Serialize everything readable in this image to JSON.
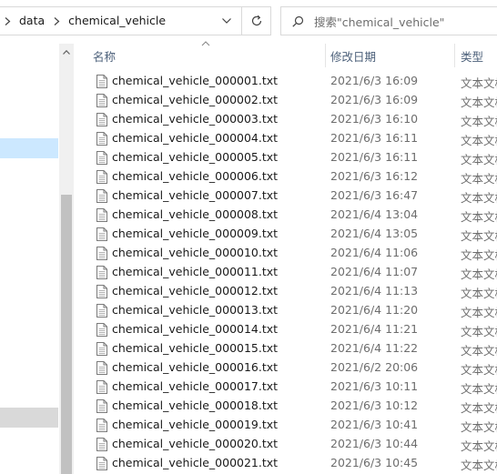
{
  "breadcrumb": {
    "items": [
      "data",
      "chemical_vehicle"
    ]
  },
  "search": {
    "placeholder": "搜索\"chemical_vehicle\""
  },
  "columns": {
    "name": "名称",
    "date": "修改日期",
    "type": "类型"
  },
  "files": [
    {
      "name": "chemical_vehicle_000001.txt",
      "date": "2021/6/3 16:09",
      "type": "文本文档"
    },
    {
      "name": "chemical_vehicle_000002.txt",
      "date": "2021/6/3 16:09",
      "type": "文本文档"
    },
    {
      "name": "chemical_vehicle_000003.txt",
      "date": "2021/6/3 16:10",
      "type": "文本文档"
    },
    {
      "name": "chemical_vehicle_000004.txt",
      "date": "2021/6/3 16:11",
      "type": "文本文档"
    },
    {
      "name": "chemical_vehicle_000005.txt",
      "date": "2021/6/3 16:11",
      "type": "文本文档"
    },
    {
      "name": "chemical_vehicle_000006.txt",
      "date": "2021/6/3 16:12",
      "type": "文本文档"
    },
    {
      "name": "chemical_vehicle_000007.txt",
      "date": "2021/6/3 16:47",
      "type": "文本文档"
    },
    {
      "name": "chemical_vehicle_000008.txt",
      "date": "2021/6/4 13:04",
      "type": "文本文档"
    },
    {
      "name": "chemical_vehicle_000009.txt",
      "date": "2021/6/4 13:05",
      "type": "文本文档"
    },
    {
      "name": "chemical_vehicle_000010.txt",
      "date": "2021/6/4 11:06",
      "type": "文本文档"
    },
    {
      "name": "chemical_vehicle_000011.txt",
      "date": "2021/6/4 11:07",
      "type": "文本文档"
    },
    {
      "name": "chemical_vehicle_000012.txt",
      "date": "2021/6/4 11:13",
      "type": "文本文档"
    },
    {
      "name": "chemical_vehicle_000013.txt",
      "date": "2021/6/4 11:20",
      "type": "文本文档"
    },
    {
      "name": "chemical_vehicle_000014.txt",
      "date": "2021/6/4 11:21",
      "type": "文本文档"
    },
    {
      "name": "chemical_vehicle_000015.txt",
      "date": "2021/6/4 11:22",
      "type": "文本文档"
    },
    {
      "name": "chemical_vehicle_000016.txt",
      "date": "2021/6/2 20:06",
      "type": "文本文档"
    },
    {
      "name": "chemical_vehicle_000017.txt",
      "date": "2021/6/3 10:11",
      "type": "文本文档"
    },
    {
      "name": "chemical_vehicle_000018.txt",
      "date": "2021/6/3 10:12",
      "type": "文本文档"
    },
    {
      "name": "chemical_vehicle_000019.txt",
      "date": "2021/6/3 10:41",
      "type": "文本文档"
    },
    {
      "name": "chemical_vehicle_000020.txt",
      "date": "2021/6/3 10:44",
      "type": "文本文档"
    },
    {
      "name": "chemical_vehicle_000021.txt",
      "date": "2021/6/3 10:45",
      "type": "文本文档"
    }
  ],
  "icons": {
    "crumb_separator": "chevron-right-icon",
    "address_dropdown": "chevron-down-icon",
    "refresh": "refresh-icon",
    "search": "search-icon",
    "file": "text-file-icon",
    "sort": "sort-ascending-icon"
  },
  "colors": {
    "selection": "#cce8ff",
    "header_text": "#4c607a",
    "secondary_text": "#6d6d6d"
  }
}
